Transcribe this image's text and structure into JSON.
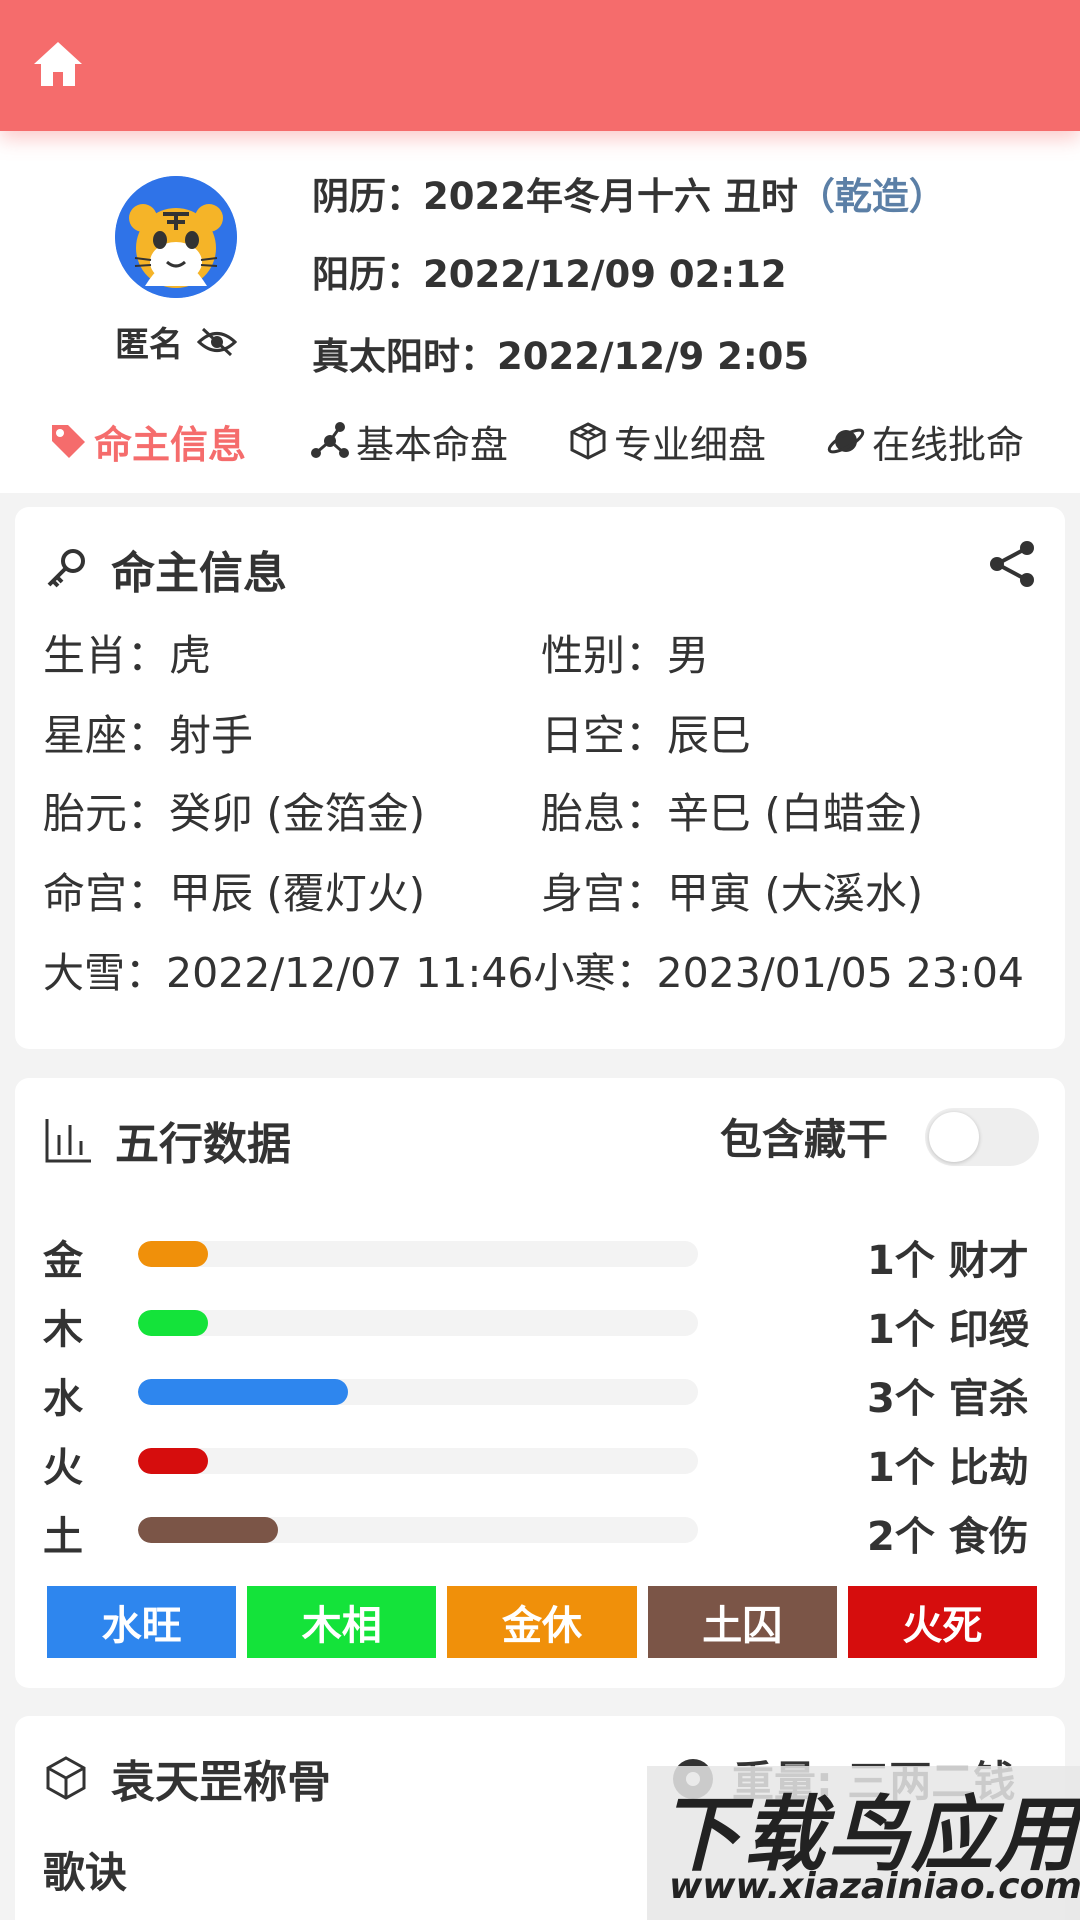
{
  "topbar": {
    "home_icon": "home-icon",
    "color": "#f56c6c"
  },
  "profile": {
    "name": "匿名",
    "lunar_label": "阴历：2022年冬月十六 丑时",
    "lunar_tag": "（乾造）",
    "solar_label": "阳历：2022/12/09 02:12",
    "true_solar_label": "真太阳时：2022/12/9 2:05"
  },
  "tabs": [
    {
      "label": "命主信息",
      "icon": "tag-icon",
      "active": true
    },
    {
      "label": "基本命盘",
      "icon": "nodes-icon",
      "active": false
    },
    {
      "label": "专业细盘",
      "icon": "cubes-icon",
      "active": false
    },
    {
      "label": "在线批命",
      "icon": "planet-icon",
      "active": false
    }
  ],
  "info_card": {
    "title": "命主信息",
    "rows": [
      [
        "生肖：虎",
        "性别：男"
      ],
      [
        "星座：射手",
        "日空：辰巳"
      ],
      [
        "胎元：癸卯 (金箔金)",
        "胎息：辛巳 (白蜡金)"
      ],
      [
        "命宫：甲辰 (覆灯火)",
        "身宫：甲寅 (大溪水)"
      ]
    ],
    "solar_terms": "大雪：2022/12/07 11:46小寒：2023/01/05 23:04"
  },
  "wuxing_card": {
    "title": "五行数据",
    "toggle_label": "包含藏干",
    "toggle_on": false,
    "elements": [
      {
        "name": "金",
        "count": 1,
        "count_label": "1个 财才",
        "color": "#f0900a"
      },
      {
        "name": "木",
        "count": 1,
        "count_label": "1个 印绶",
        "color": "#14e33a"
      },
      {
        "name": "水",
        "count": 3,
        "count_label": "3个 官杀",
        "color": "#2e86ee"
      },
      {
        "name": "火",
        "count": 1,
        "count_label": "1个 比劫",
        "color": "#d60d0d"
      },
      {
        "name": "土",
        "count": 2,
        "count_label": "2个 食伤",
        "color": "#7b5547"
      }
    ],
    "max_count": 8,
    "status": [
      {
        "label": "水旺",
        "color": "#2e86ee"
      },
      {
        "label": "木相",
        "color": "#14e33a"
      },
      {
        "label": "金休",
        "color": "#f0900a"
      },
      {
        "label": "土囚",
        "color": "#7b5547"
      },
      {
        "label": "火死",
        "color": "#d60d0d"
      }
    ]
  },
  "bone_card": {
    "title": "袁天罡称骨",
    "weight_label": "重量: 三两二钱",
    "verse_label": "歌诀"
  },
  "watermark": {
    "line1": "下载鸟应用",
    "line2": "www.xiazainiao.com"
  }
}
